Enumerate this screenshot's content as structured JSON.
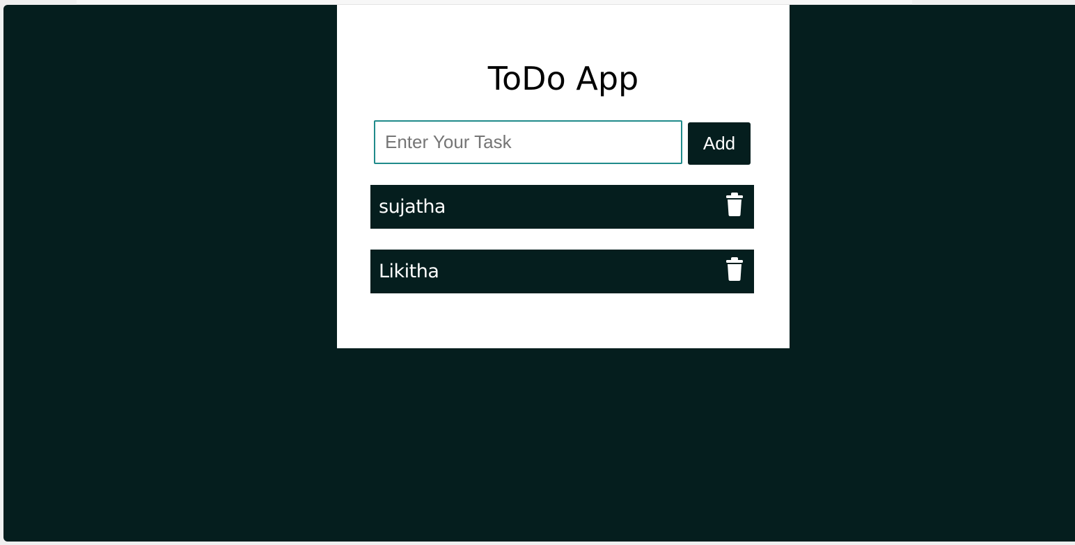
{
  "app": {
    "title": "ToDo App"
  },
  "input": {
    "placeholder": "Enter Your Task",
    "value": ""
  },
  "add_button": {
    "label": "Add"
  },
  "tasks": [
    {
      "text": "sujatha",
      "action_icon": "trash-icon"
    },
    {
      "text": "Likitha",
      "action_icon": "trash-icon"
    }
  ],
  "colors": {
    "background": "#051e1e",
    "card": "#ffffff",
    "input_border": "#1f8a8a",
    "task_bg": "#051e1e",
    "task_text": "#ffffff"
  }
}
